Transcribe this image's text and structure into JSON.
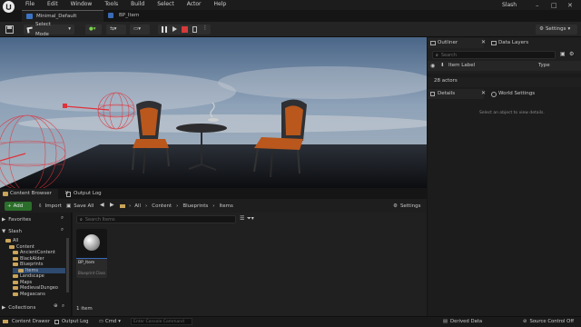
{
  "menubar": {
    "items": [
      "File",
      "Edit",
      "Window",
      "Tools",
      "Build",
      "Select",
      "Actor",
      "Help"
    ],
    "user": "Slash"
  },
  "tabs": {
    "level": "Minimal_Default",
    "blueprint": "BP_Item"
  },
  "toolbar": {
    "select_mode": "Select Mode",
    "settings": "Settings"
  },
  "outliner": {
    "tab": "Outliner",
    "layers_tab": "Data Layers",
    "search_placeholder": "Search",
    "col_label": "Item Label",
    "col_type": "Type",
    "actors": "28 actors"
  },
  "details": {
    "tab": "Details",
    "world_tab": "World Settings",
    "empty": "Select an object to view details."
  },
  "content_browser": {
    "tab": "Content Browser",
    "log_tab": "Output Log",
    "add": "Add",
    "import": "Import",
    "save_all": "Save All",
    "breadcrumb": [
      "All",
      "Content",
      "Blueprints",
      "Items"
    ],
    "settings": "Settings",
    "search_placeholder": "Search Items",
    "favorites": "Favorites",
    "project": "Slash",
    "tree": [
      "All",
      "Content",
      "AncientContent",
      "BlackAlder",
      "Blueprints",
      "Items",
      "Landscape",
      "Maps",
      "MedievalDungeo",
      "Megascans"
    ],
    "collections": "Collections",
    "asset_name": "BP_Item",
    "asset_type": "Blueprint Class",
    "count": "1 item"
  },
  "statusbar": {
    "drawer": "Content Drawer",
    "log": "Output Log",
    "cmd": "Cmd",
    "cmd_placeholder": "Enter Console Command",
    "derived": "Derived Data",
    "source": "Source Control Off"
  },
  "colors": {
    "accent": "#3a8ee6",
    "add_button": "#2b6e2b",
    "play": "#6fce4a",
    "stop": "#d63a3a"
  }
}
